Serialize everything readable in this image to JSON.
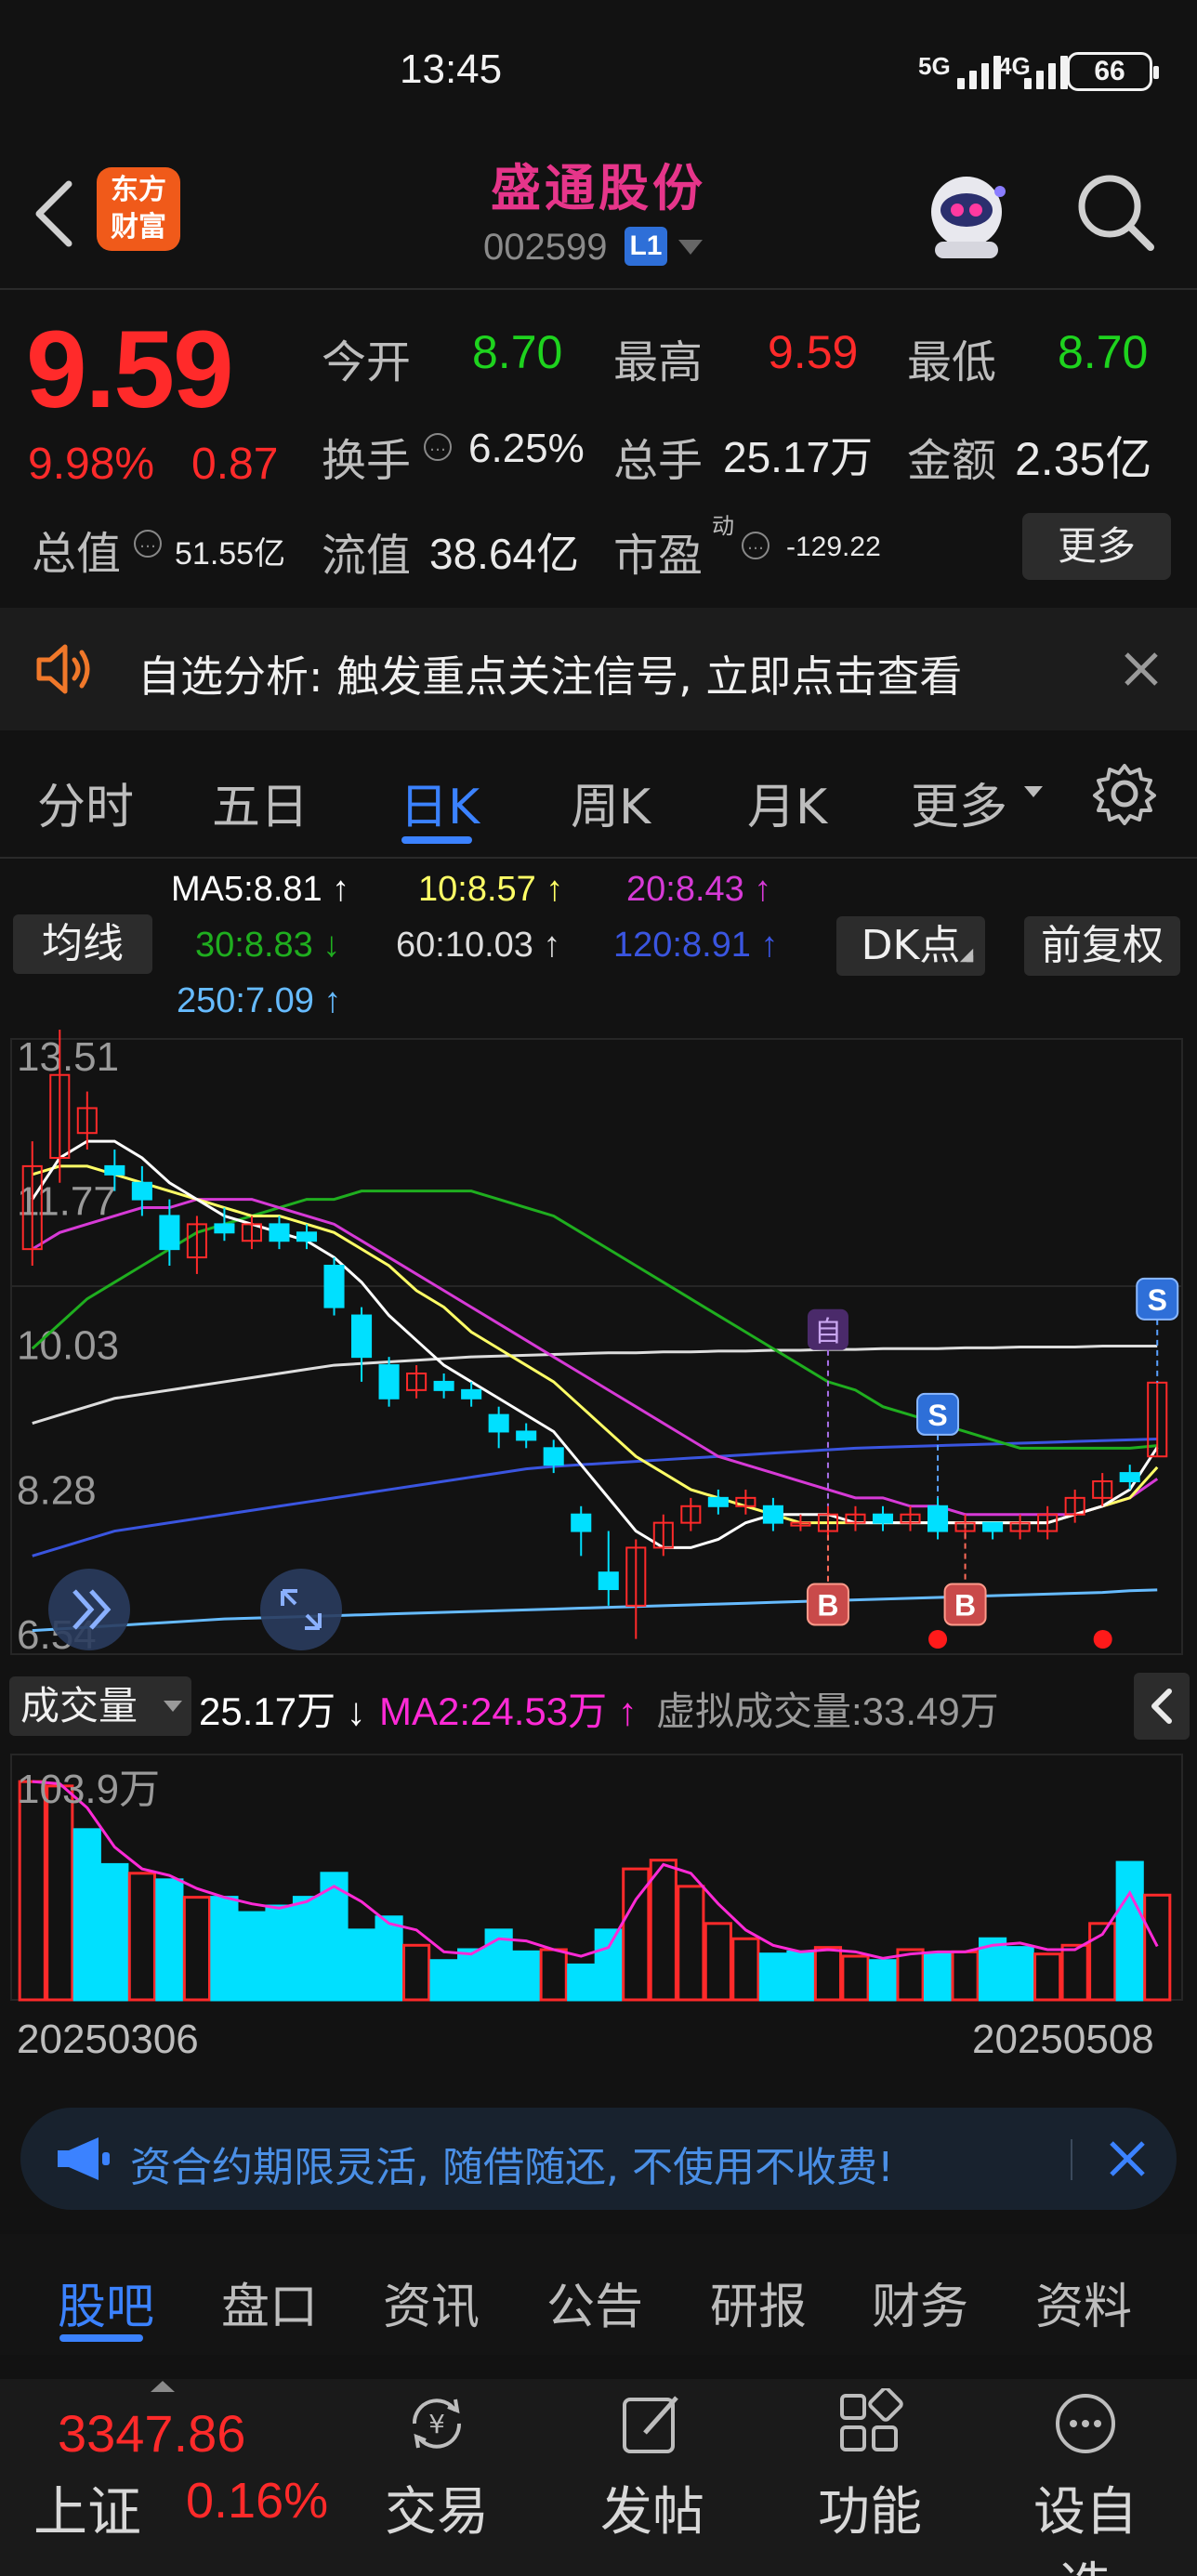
{
  "status": {
    "time": "13:45",
    "net1": "5G",
    "net2": "4G",
    "battery": "66"
  },
  "header": {
    "logo": [
      "东方",
      "财富"
    ],
    "title": "盛通股份",
    "code": "002599",
    "level": "L1"
  },
  "quote": {
    "price": "9.59",
    "change_pct": "9.98%",
    "change": "0.87",
    "total_value_label": "总值",
    "total_value": "51.55亿",
    "rows": {
      "open_label": "今开",
      "open": "8.70",
      "high_label": "最高",
      "high": "9.59",
      "low_label": "最低",
      "low": "8.70",
      "turnover_label": "换手",
      "turnover": "6.25%",
      "volume_label": "总手",
      "volume": "25.17万",
      "amount_label": "金额",
      "amount": "2.35亿",
      "float_label": "流值",
      "float_value": "38.64亿",
      "pe_label": "市盈",
      "pe_sup": "动",
      "pe": "-129.22"
    },
    "more_label": "更多"
  },
  "notice": {
    "text": "自选分析: 触发重点关注信号, 立即点击查看"
  },
  "tabs": {
    "items": [
      "分时",
      "五日",
      "日K",
      "周K",
      "月K",
      "更多"
    ],
    "active": "日K"
  },
  "ma_legend": {
    "ma5": "MA5:8.81",
    "ma10": "10:8.57",
    "ma20": "20:8.43",
    "ma30": "30:8.83",
    "ma60": "60:10.03",
    "ma120": "120:8.91",
    "ma250": "250:7.09",
    "arrows": {
      "ma5": "↑",
      "ma10": "↑",
      "ma20": "↑",
      "ma30": "↓",
      "ma60": "↑",
      "ma120": "↑",
      "ma250": "↑"
    },
    "chip_left": "均线",
    "chip_dk": "DK点",
    "chip_adj": "前复权"
  },
  "kline": {
    "y_labels": [
      "13.51",
      "11.77",
      "10.03",
      "8.28",
      "6.54"
    ],
    "markers": {
      "buy": "B",
      "sell": "S",
      "self": "自"
    }
  },
  "volume": {
    "chip": "成交量",
    "value": "25.17万",
    "value_arrow": "↓",
    "ma2": "MA2:24.53万",
    "ma2_arrow": "↑",
    "virtual": "虚拟成交量:33.49万",
    "y_top": "103.9万"
  },
  "dates": {
    "start": "20250306",
    "end": "20250508"
  },
  "ad": {
    "text": "资合约期限灵活, 随借随还, 不使用不收费!"
  },
  "bottom_tabs": {
    "items": [
      "股吧",
      "盘口",
      "资讯",
      "公告",
      "研报",
      "财务",
      "资料"
    ],
    "active": "股吧"
  },
  "bottom_nav": {
    "index_value": "3347.86",
    "index_name": "上证",
    "index_pct": "0.16%",
    "items": [
      "交易",
      "发帖",
      "功能",
      "设自选"
    ]
  },
  "colors": {
    "up": "#ff2a2a",
    "down": "#00e0ff",
    "ma5": "#ffffff",
    "ma10": "#ffff66",
    "ma20": "#d63ad6",
    "ma30": "#1fae1f",
    "ma60": "#dddddd",
    "ma120": "#3a55e0",
    "ma250": "#66bbff",
    "accent": "#3b82ff",
    "title": "#e6358a"
  },
  "chart_data": [
    {
      "type": "candlestick",
      "x_range": [
        "20250306",
        "20250508"
      ],
      "ylim": [
        6.54,
        13.51
      ],
      "y_ticks": [
        13.51,
        11.77,
        10.03,
        8.28,
        6.54
      ],
      "candles": [
        {
          "o": 11.2,
          "c": 12.2,
          "h": 12.5,
          "l": 11.0
        },
        {
          "o": 12.3,
          "c": 13.3,
          "h": 13.9,
          "l": 12.0
        },
        {
          "o": 12.6,
          "c": 12.9,
          "h": 13.1,
          "l": 12.4
        },
        {
          "o": 12.2,
          "c": 12.1,
          "h": 12.4,
          "l": 11.9
        },
        {
          "o": 12.0,
          "c": 11.8,
          "h": 12.2,
          "l": 11.6
        },
        {
          "o": 11.6,
          "c": 11.2,
          "h": 11.8,
          "l": 11.0
        },
        {
          "o": 11.1,
          "c": 11.5,
          "h": 11.6,
          "l": 10.9
        },
        {
          "o": 11.5,
          "c": 11.4,
          "h": 11.7,
          "l": 11.3
        },
        {
          "o": 11.3,
          "c": 11.5,
          "h": 11.6,
          "l": 11.2
        },
        {
          "o": 11.5,
          "c": 11.3,
          "h": 11.6,
          "l": 11.2
        },
        {
          "o": 11.4,
          "c": 11.3,
          "h": 11.5,
          "l": 11.2
        },
        {
          "o": 11.0,
          "c": 10.5,
          "h": 11.1,
          "l": 10.4
        },
        {
          "o": 10.4,
          "c": 9.9,
          "h": 10.5,
          "l": 9.6
        },
        {
          "o": 9.8,
          "c": 9.4,
          "h": 9.9,
          "l": 9.3
        },
        {
          "o": 9.5,
          "c": 9.7,
          "h": 9.8,
          "l": 9.4
        },
        {
          "o": 9.6,
          "c": 9.5,
          "h": 9.7,
          "l": 9.4
        },
        {
          "o": 9.5,
          "c": 9.4,
          "h": 9.6,
          "l": 9.3
        },
        {
          "o": 9.2,
          "c": 9.0,
          "h": 9.3,
          "l": 8.8
        },
        {
          "o": 9.0,
          "c": 8.9,
          "h": 9.1,
          "l": 8.8
        },
        {
          "o": 8.8,
          "c": 8.6,
          "h": 8.9,
          "l": 8.5
        },
        {
          "o": 8.0,
          "c": 7.8,
          "h": 8.1,
          "l": 7.5
        },
        {
          "o": 7.3,
          "c": 7.1,
          "h": 7.8,
          "l": 6.9
        },
        {
          "o": 6.9,
          "c": 7.6,
          "h": 7.7,
          "l": 6.5
        },
        {
          "o": 7.6,
          "c": 7.9,
          "h": 8.0,
          "l": 7.5
        },
        {
          "o": 7.9,
          "c": 8.1,
          "h": 8.2,
          "l": 7.8
        },
        {
          "o": 8.2,
          "c": 8.1,
          "h": 8.3,
          "l": 8.0
        },
        {
          "o": 8.1,
          "c": 8.2,
          "h": 8.3,
          "l": 8.0
        },
        {
          "o": 8.1,
          "c": 7.9,
          "h": 8.2,
          "l": 7.8
        },
        {
          "o": 7.9,
          "c": 7.9,
          "h": 8.0,
          "l": 7.8
        },
        {
          "o": 7.8,
          "c": 8.0,
          "h": 8.1,
          "l": 7.7
        },
        {
          "o": 7.9,
          "c": 8.0,
          "h": 8.1,
          "l": 7.8
        },
        {
          "o": 8.0,
          "c": 7.9,
          "h": 8.1,
          "l": 7.8
        },
        {
          "o": 7.9,
          "c": 8.0,
          "h": 8.1,
          "l": 7.8
        },
        {
          "o": 8.1,
          "c": 7.8,
          "h": 8.2,
          "l": 7.7
        },
        {
          "o": 7.8,
          "c": 7.9,
          "h": 8.0,
          "l": 7.7
        },
        {
          "o": 7.9,
          "c": 7.8,
          "h": 7.9,
          "l": 7.7
        },
        {
          "o": 7.8,
          "c": 7.9,
          "h": 8.0,
          "l": 7.7
        },
        {
          "o": 7.8,
          "c": 8.0,
          "h": 8.1,
          "l": 7.7
        },
        {
          "o": 8.0,
          "c": 8.2,
          "h": 8.3,
          "l": 7.9
        },
        {
          "o": 8.2,
          "c": 8.4,
          "h": 8.5,
          "l": 8.1
        },
        {
          "o": 8.5,
          "c": 8.4,
          "h": 8.6,
          "l": 8.3
        },
        {
          "o": 8.7,
          "c": 9.59,
          "h": 9.59,
          "l": 8.7
        }
      ],
      "ma_lines": {
        "ma5": [
          11.8,
          12.3,
          12.5,
          12.5,
          12.3,
          12.0,
          11.8,
          11.6,
          11.5,
          11.4,
          11.3,
          11.1,
          10.8,
          10.4,
          10.1,
          9.8,
          9.6,
          9.4,
          9.2,
          9.0,
          8.6,
          8.2,
          7.8,
          7.6,
          7.6,
          7.7,
          7.9,
          8.0,
          8.0,
          8.0,
          7.9,
          7.9,
          7.9,
          7.9,
          7.9,
          7.9,
          7.9,
          7.9,
          8.0,
          8.1,
          8.3,
          8.81
        ],
        "ma10": [
          12.1,
          12.2,
          12.2,
          12.1,
          12.0,
          11.9,
          11.8,
          11.7,
          11.6,
          11.6,
          11.5,
          11.4,
          11.2,
          11.0,
          10.7,
          10.5,
          10.2,
          10.0,
          9.8,
          9.6,
          9.3,
          9.0,
          8.7,
          8.5,
          8.3,
          8.2,
          8.1,
          8.0,
          7.9,
          7.9,
          7.9,
          7.9,
          7.9,
          7.9,
          7.9,
          7.9,
          7.9,
          7.9,
          8.0,
          8.1,
          8.2,
          8.57
        ],
        "ma20": [
          11.2,
          11.4,
          11.5,
          11.6,
          11.7,
          11.7,
          11.8,
          11.8,
          11.8,
          11.7,
          11.6,
          11.5,
          11.3,
          11.1,
          10.9,
          10.7,
          10.5,
          10.3,
          10.1,
          9.9,
          9.7,
          9.5,
          9.3,
          9.1,
          8.9,
          8.7,
          8.6,
          8.5,
          8.4,
          8.3,
          8.2,
          8.2,
          8.1,
          8.1,
          8.0,
          8.0,
          8.0,
          8.0,
          8.0,
          8.1,
          8.2,
          8.43
        ],
        "ma30": [
          10.0,
          10.3,
          10.6,
          10.8,
          11.0,
          11.2,
          11.4,
          11.5,
          11.6,
          11.7,
          11.8,
          11.8,
          11.9,
          11.9,
          11.9,
          11.9,
          11.9,
          11.8,
          11.7,
          11.6,
          11.4,
          11.2,
          11.0,
          10.8,
          10.6,
          10.4,
          10.2,
          10.0,
          9.8,
          9.6,
          9.5,
          9.3,
          9.2,
          9.1,
          9.0,
          8.9,
          8.8,
          8.8,
          8.8,
          8.8,
          8.8,
          8.83
        ],
        "ma60": [
          9.1,
          9.2,
          9.3,
          9.4,
          9.45,
          9.5,
          9.55,
          9.6,
          9.65,
          9.7,
          9.75,
          9.8,
          9.82,
          9.84,
          9.86,
          9.88,
          9.9,
          9.91,
          9.92,
          9.93,
          9.94,
          9.95,
          9.95,
          9.96,
          9.96,
          9.97,
          9.97,
          9.98,
          9.98,
          9.99,
          9.99,
          10.0,
          10.0,
          10.0,
          10.01,
          10.01,
          10.02,
          10.02,
          10.02,
          10.03,
          10.03,
          10.03
        ],
        "ma120": [
          7.5,
          7.6,
          7.7,
          7.8,
          7.85,
          7.9,
          7.95,
          8.0,
          8.05,
          8.1,
          8.15,
          8.2,
          8.25,
          8.3,
          8.35,
          8.4,
          8.45,
          8.5,
          8.55,
          8.58,
          8.6,
          8.62,
          8.64,
          8.66,
          8.68,
          8.7,
          8.72,
          8.74,
          8.76,
          8.78,
          8.8,
          8.81,
          8.82,
          8.83,
          8.84,
          8.85,
          8.86,
          8.87,
          8.88,
          8.89,
          8.9,
          8.91
        ],
        "ma250": [
          6.6,
          6.62,
          6.64,
          6.66,
          6.68,
          6.7,
          6.72,
          6.74,
          6.75,
          6.76,
          6.77,
          6.78,
          6.79,
          6.8,
          6.81,
          6.82,
          6.83,
          6.84,
          6.85,
          6.86,
          6.87,
          6.88,
          6.89,
          6.9,
          6.91,
          6.92,
          6.93,
          6.94,
          6.95,
          6.96,
          6.97,
          6.98,
          6.99,
          7.0,
          7.01,
          7.02,
          7.03,
          7.04,
          7.05,
          7.06,
          7.08,
          7.09
        ]
      },
      "signals": [
        {
          "index": 29,
          "type": "自"
        },
        {
          "index": 29,
          "type": "B"
        },
        {
          "index": 33,
          "type": "S"
        },
        {
          "index": 34,
          "type": "B"
        },
        {
          "index": 41,
          "type": "S"
        }
      ]
    },
    {
      "type": "bar",
      "title": "成交量",
      "ylim": [
        0,
        103.9
      ],
      "y_top_label": "103.9万",
      "values": [
        100,
        98,
        78,
        62,
        58,
        55,
        47,
        47,
        40,
        43,
        47,
        58,
        32,
        38,
        25,
        18,
        23,
        32,
        22,
        23,
        16,
        32,
        60,
        64,
        52,
        35,
        28,
        21,
        22,
        24,
        20,
        18,
        23,
        21,
        22,
        28,
        24,
        21,
        25,
        35,
        63,
        48
      ],
      "up": [
        1,
        1,
        0,
        0,
        1,
        0,
        1,
        0,
        0,
        0,
        0,
        0,
        0,
        0,
        1,
        0,
        0,
        0,
        0,
        1,
        0,
        0,
        1,
        1,
        1,
        1,
        1,
        0,
        0,
        1,
        1,
        0,
        1,
        0,
        1,
        0,
        0,
        1,
        1,
        1,
        0,
        1
      ],
      "ma2": [
        100,
        99,
        88,
        70,
        60,
        57,
        51,
        47,
        44,
        42,
        45,
        52,
        45,
        35,
        32,
        22,
        21,
        28,
        27,
        23,
        20,
        24,
        46,
        62,
        58,
        44,
        32,
        25,
        22,
        23,
        22,
        19,
        21,
        22,
        22,
        25,
        26,
        23,
        23,
        30,
        49,
        24.53
      ]
    }
  ]
}
